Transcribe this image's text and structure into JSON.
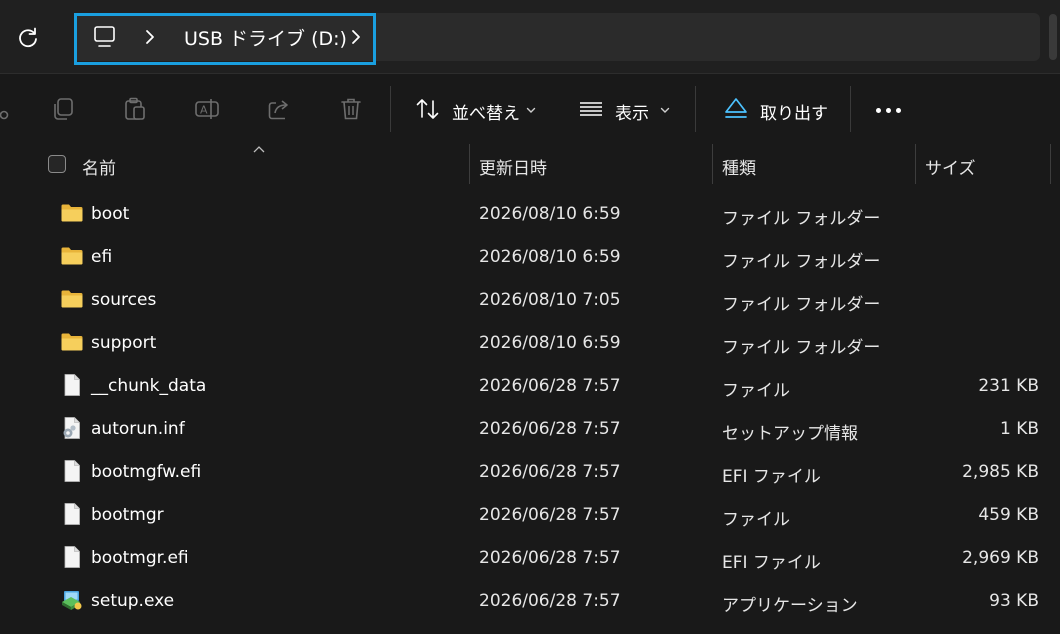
{
  "address_bar": {
    "breadcrumb_root_icon": "pc-monitor-icon",
    "breadcrumb_drive": "USB ドライブ (D:)"
  },
  "command_bar": {
    "sort_label": "並べ替え",
    "view_label": "表示",
    "eject_label": "取り出す",
    "icons": [
      "cut-icon",
      "copy-icon",
      "paste-icon",
      "rename-icon",
      "share-icon",
      "delete-icon",
      "sort-icon",
      "view-icon",
      "eject-icon",
      "more-icon"
    ]
  },
  "columns": {
    "name": "名前",
    "date": "更新日時",
    "type": "種類",
    "size": "サイズ"
  },
  "files": [
    {
      "name": "boot",
      "date": "2026/08/10 6:59",
      "type": "ファイル フォルダー",
      "size": "",
      "icon": "folder-icon"
    },
    {
      "name": "efi",
      "date": "2026/08/10 6:59",
      "type": "ファイル フォルダー",
      "size": "",
      "icon": "folder-icon"
    },
    {
      "name": "sources",
      "date": "2026/08/10 7:05",
      "type": "ファイル フォルダー",
      "size": "",
      "icon": "folder-icon"
    },
    {
      "name": "support",
      "date": "2026/08/10 6:59",
      "type": "ファイル フォルダー",
      "size": "",
      "icon": "folder-icon"
    },
    {
      "name": "__chunk_data",
      "date": "2026/06/28 7:57",
      "type": "ファイル",
      "size": "231 KB",
      "icon": "file-icon"
    },
    {
      "name": "autorun.inf",
      "date": "2026/06/28 7:57",
      "type": "セットアップ情報",
      "size": "1 KB",
      "icon": "setup-info-icon"
    },
    {
      "name": "bootmgfw.efi",
      "date": "2026/06/28 7:57",
      "type": "EFI ファイル",
      "size": "2,985 KB",
      "icon": "file-icon"
    },
    {
      "name": "bootmgr",
      "date": "2026/06/28 7:57",
      "type": "ファイル",
      "size": "459 KB",
      "icon": "file-icon"
    },
    {
      "name": "bootmgr.efi",
      "date": "2026/06/28 7:57",
      "type": "EFI ファイル",
      "size": "2,969 KB",
      "icon": "file-icon"
    },
    {
      "name": "setup.exe",
      "date": "2026/06/28 7:57",
      "type": "アプリケーション",
      "size": "93 KB",
      "icon": "application-icon"
    }
  ],
  "colors": {
    "background": "#191919",
    "address_highlight": "#1a9fe0",
    "folder": "#f4c542",
    "eject_accent": "#4cc2ff"
  }
}
